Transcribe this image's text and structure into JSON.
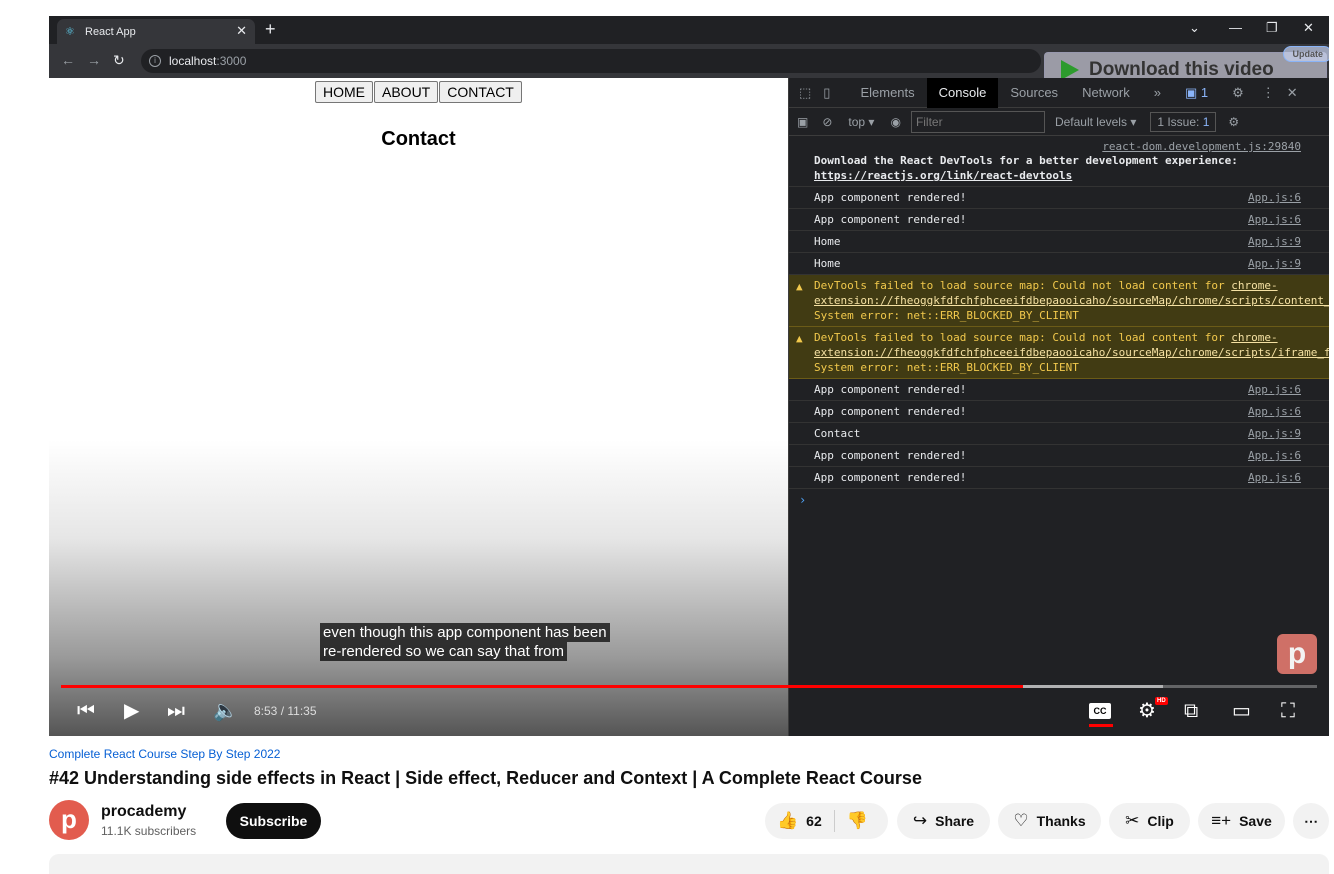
{
  "browser": {
    "tab_title": "React App",
    "tab_icon": "react-icon",
    "url_host": "localhost",
    "url_port": ":3000",
    "download_banner": "Download this video",
    "update_label": "Update"
  },
  "app": {
    "nav": [
      "HOME",
      "ABOUT",
      "CONTACT"
    ],
    "heading": "Contact"
  },
  "devtools": {
    "tabs": [
      "Elements",
      "Console",
      "Sources",
      "Network"
    ],
    "active_tab": "Console",
    "badge_count": "1",
    "context": "top",
    "filter_placeholder": "Filter",
    "levels": "Default levels",
    "issues_label": "1 Issue:",
    "issues_count": "1",
    "console": [
      {
        "type": "info",
        "src": "react-dom.development.js:29840",
        "text": "Download the React DevTools for a better development experience: ",
        "link": "https://reactjs.org/link/react-devtools"
      },
      {
        "type": "log",
        "text": "App component rendered!",
        "src": "App.js:6"
      },
      {
        "type": "log",
        "text": "App component rendered!",
        "src": "App.js:6"
      },
      {
        "type": "log",
        "text": "Home",
        "src": "App.js:9"
      },
      {
        "type": "log",
        "text": "Home",
        "src": "App.js:9"
      },
      {
        "type": "warn",
        "text": "DevTools failed to load source map: Could not load content for ",
        "link": "chrome-extension://fheoggkfdfchfphceeifdbepaooicaho/sourceMap/chrome/scripts/content_scroll_mid_detection.map",
        "tail": ": System error: net::ERR_BLOCKED_BY_CLIENT"
      },
      {
        "type": "warn",
        "text": "DevTools failed to load source map: Could not load content for ",
        "link": "chrome-extension://fheoggkfdfchfphceeifdbepaooicaho/sourceMap/chrome/scripts/iframe_form_check.map",
        "tail": ": System error: net::ERR_BLOCKED_BY_CLIENT"
      },
      {
        "type": "log",
        "text": "App component rendered!",
        "src": "App.js:6"
      },
      {
        "type": "log",
        "text": "App component rendered!",
        "src": "App.js:6"
      },
      {
        "type": "log",
        "text": "Contact",
        "src": "App.js:9"
      },
      {
        "type": "log",
        "text": "App component rendered!",
        "src": "App.js:6"
      },
      {
        "type": "log",
        "text": "App component rendered!",
        "src": "App.js:6"
      }
    ]
  },
  "player": {
    "caption_line1": "even though this app component has been",
    "caption_line2": "re-rendered so we can say that from",
    "time": "8:53 / 11:35",
    "progress_fraction": 0.766,
    "buffered_fraction": 0.877,
    "progress_color": "#ff0000"
  },
  "video": {
    "playlist": "Complete React Course Step By Step 2022",
    "title": "#42 Understanding side effects in React | Side effect, Reducer and Context | A Complete React Course",
    "channel": "procademy",
    "subscribers": "11.1K subscribers",
    "subscribe_label": "Subscribe",
    "likes": "62",
    "share_label": "Share",
    "thanks_label": "Thanks",
    "clip_label": "Clip",
    "save_label": "Save"
  }
}
